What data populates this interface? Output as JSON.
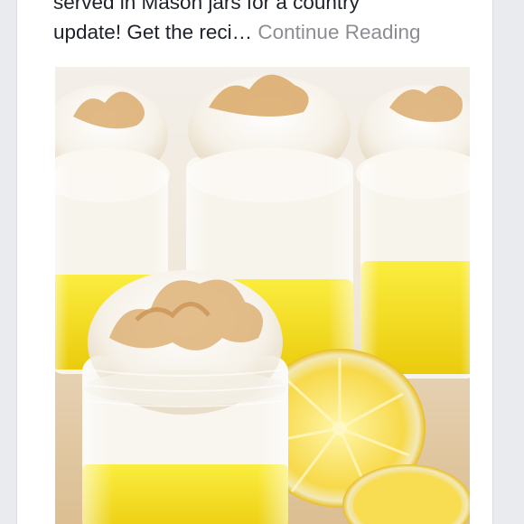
{
  "post": {
    "text_line1": "served in Mason jars for a country",
    "text_line2": "update! Get the reci…",
    "continue_label": "Continue Reading"
  },
  "photo": {
    "subject": "lemon meringue desserts in mason jars with lemon halves"
  },
  "colors": {
    "page_bg": "#e9ebee",
    "card_bg": "#ffffff",
    "text": "#1d2129",
    "link": "#8b8d92",
    "lemon_curd": "#f4e21a",
    "meringue": "#fbf8f2",
    "meringue_toast": "#d9a866"
  }
}
